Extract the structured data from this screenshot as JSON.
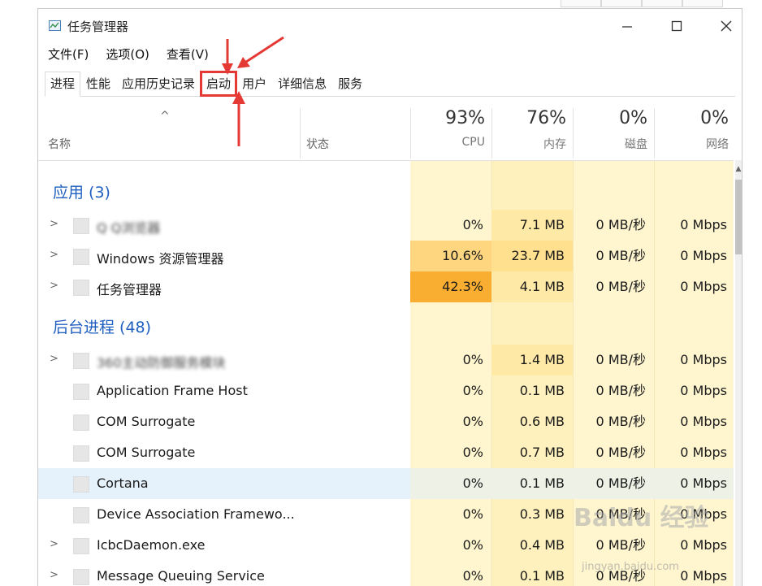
{
  "window": {
    "title": "任务管理器"
  },
  "menu": [
    "文件(F)",
    "选项(O)",
    "查看(V)"
  ],
  "tabs": [
    "进程",
    "性能",
    "应用历史记录",
    "启动",
    "用户",
    "详细信息",
    "服务"
  ],
  "columns": {
    "name": "名称",
    "status": "状态",
    "cpu": {
      "pct": "93%",
      "label": "CPU"
    },
    "mem": {
      "pct": "76%",
      "label": "内存"
    },
    "disk": {
      "pct": "0%",
      "label": "磁盘"
    },
    "net": {
      "pct": "0%",
      "label": "网络"
    }
  },
  "sections": {
    "apps": "应用 (3)",
    "background": "后台进程 (48)"
  },
  "apps": [
    {
      "name": "Q Q浏览器",
      "cpu": "0%",
      "mem": "7.1 MB",
      "disk": "0 MB/秒",
      "net": "0 Mbps"
    },
    {
      "name": "Windows 资源管理器",
      "cpu": "10.6%",
      "mem": "23.7 MB",
      "disk": "0 MB/秒",
      "net": "0 Mbps"
    },
    {
      "name": "任务管理器",
      "cpu": "42.3%",
      "mem": "4.1 MB",
      "disk": "0 MB/秒",
      "net": "0 Mbps"
    }
  ],
  "background": [
    {
      "name": "360主动防御服务模块",
      "cpu": "0%",
      "mem": "1.4 MB",
      "disk": "0 MB/秒",
      "net": "0 Mbps"
    },
    {
      "name": "Application Frame Host",
      "cpu": "0%",
      "mem": "0.1 MB",
      "disk": "0 MB/秒",
      "net": "0 Mbps"
    },
    {
      "name": "COM Surrogate",
      "cpu": "0%",
      "mem": "0.6 MB",
      "disk": "0 MB/秒",
      "net": "0 Mbps"
    },
    {
      "name": "COM Surrogate",
      "cpu": "0%",
      "mem": "0.7 MB",
      "disk": "0 MB/秒",
      "net": "0 Mbps"
    },
    {
      "name": "Cortana",
      "cpu": "0%",
      "mem": "0.1 MB",
      "disk": "0 MB/秒",
      "net": "0 Mbps"
    },
    {
      "name": "Device Association Framewo...",
      "cpu": "0%",
      "mem": "0.3 MB",
      "disk": "0 MB/秒",
      "net": "0 Mbps"
    },
    {
      "name": "IcbcDaemon.exe",
      "cpu": "0%",
      "mem": "0.4 MB",
      "disk": "0 MB/秒",
      "net": "0 Mbps"
    },
    {
      "name": "Message Queuing Service",
      "cpu": "0%",
      "mem": "0.1 MB",
      "disk": "0 MB/秒",
      "net": "0 Mbps"
    }
  ],
  "watermark": {
    "brand": "Baidu 经验",
    "url": "jingyan.baidu.com"
  },
  "colors": {
    "heat_light": "#fff4c4",
    "heat_mid": "#ffdf8a",
    "heat_high": "#fbb13c",
    "section_blue": "#1f5fbf",
    "highlight_red": "#e53935"
  }
}
